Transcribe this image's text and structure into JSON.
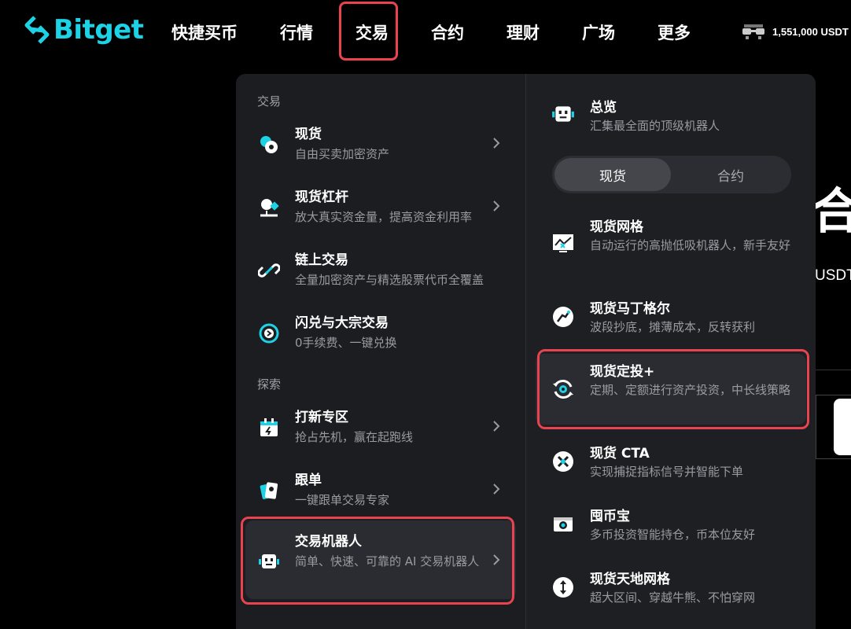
{
  "brand": {
    "name": "Bitget",
    "accent": "#1ed2e6",
    "highlight_border": "#e8434f"
  },
  "nav": {
    "items": [
      "快捷买币",
      "行情",
      "交易",
      "合约",
      "理财",
      "广场",
      "更多"
    ],
    "active": "交易",
    "balance": "1,551,000 USDT"
  },
  "background": {
    "partial_heading": "合",
    "partial_unit": "USDT"
  },
  "menu": {
    "left": {
      "section_trade": "交易",
      "section_explore": "探索",
      "items": [
        {
          "title": "现货",
          "desc": "自由买卖加密资产",
          "icon": "spot-coins-icon"
        },
        {
          "title": "现货杠杆",
          "desc": "放大真实资金量，提高资金利用率",
          "icon": "margin-icon"
        },
        {
          "title": "链上交易",
          "desc": "全量加密资产与精选股票代币全覆盖",
          "icon": "onchain-link-icon"
        },
        {
          "title": "闪兑与大宗交易",
          "desc": "0手续费、一键兑换",
          "icon": "swap-convert-icon"
        },
        {
          "title": "打新专区",
          "desc": "抢占先机，赢在起跑线",
          "icon": "launchpad-calendar-icon"
        },
        {
          "title": "跟单",
          "desc": "一键跟单交易专家",
          "icon": "copy-trade-cards-icon"
        },
        {
          "title": "交易机器人",
          "desc": "简单、快速、可靠的 AI 交易机器人",
          "icon": "robot-icon"
        }
      ]
    },
    "right": {
      "overview_title": "总览",
      "overview_desc": "汇集最全面的顶级机器人",
      "tabs": [
        "现货",
        "合约"
      ],
      "active_tab": "现货",
      "bots": [
        {
          "title": "现货网格",
          "desc": "自动运行的高抛低吸机器人，新手友好",
          "icon": "grid-chart-icon"
        },
        {
          "title": "现货马丁格尔",
          "desc": "波段抄底，摊薄成本，反转获利",
          "icon": "martingale-curve-icon"
        },
        {
          "title": "现货定投+",
          "desc": "定期、定额进行资产投资，中长线策略",
          "icon": "recurring-invest-icon"
        },
        {
          "title": "现货 CTA",
          "desc": "实现捕捉指标信号并智能下单",
          "icon": "cta-signal-icon"
        },
        {
          "title": "囤币宝",
          "desc": "多币投资智能持仓，币本位友好",
          "icon": "hodl-wallet-icon"
        },
        {
          "title": "现货天地网格",
          "desc": "超大区间、穿越牛熊、不怕穿网",
          "icon": "infinity-grid-icon"
        }
      ]
    }
  }
}
